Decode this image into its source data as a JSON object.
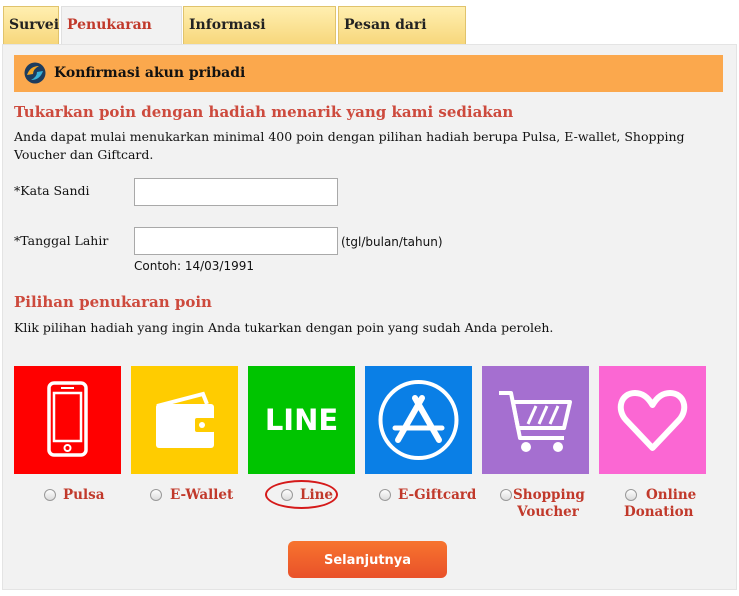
{
  "tabs": [
    {
      "label": "Survei"
    },
    {
      "label": "Penukaran poin"
    },
    {
      "label": "Informasi Registrasi"
    },
    {
      "label": "Pesan dari teman"
    }
  ],
  "header": {
    "title": "Konfirmasi akun pribadi",
    "icon": "logo-icon"
  },
  "section1": {
    "title": "Tukarkan poin dengan hadiah menarik yang kami sediakan",
    "description": "Anda dapat mulai menukarkan minimal 400 poin dengan pilihan hadiah berupa Pulsa, E-wallet, Shopping Voucher dan Giftcard."
  },
  "form": {
    "password_label": "*Kata Sandi",
    "password_value": "",
    "birthdate_label": "*Tanggal Lahir",
    "birthdate_value": "",
    "birthdate_hint": "(tgl/bulan/tahun)",
    "birthdate_example": "Contoh: 14/03/1991"
  },
  "section2": {
    "title": "Pilihan penukaran poin",
    "description": "Klik pilihan hadiah yang ingin Anda tukarkan dengan poin yang sudah Anda peroleh."
  },
  "options": [
    {
      "label": "Pulsa",
      "icon": "phone-icon",
      "color": "#ff0000",
      "selected": false
    },
    {
      "label": "E-Wallet",
      "icon": "wallet-icon",
      "color": "#ffcc00",
      "selected": false
    },
    {
      "label": "Line",
      "icon": "line-logo-icon",
      "color": "#00c400",
      "selected": false,
      "text": "LINE"
    },
    {
      "label": "E-Giftcard",
      "icon": "app-store-icon",
      "color": "#0a7fe6",
      "selected": false
    },
    {
      "label_line1": "Shopping",
      "label_line2": "Voucher",
      "icon": "shopping-cart-icon",
      "color": "#a56fd0",
      "selected": false
    },
    {
      "label_line1": "Online",
      "label_line2": "Donation",
      "icon": "heart-icon",
      "color": "#fb67d3",
      "selected": false
    }
  ],
  "next_button": {
    "label": "Selanjutnya"
  },
  "colors": {
    "accent_red": "#cd4a3d",
    "header_orange": "#fba84d",
    "button_orange": "#f06a2c",
    "highlight": "#d51a1a"
  }
}
